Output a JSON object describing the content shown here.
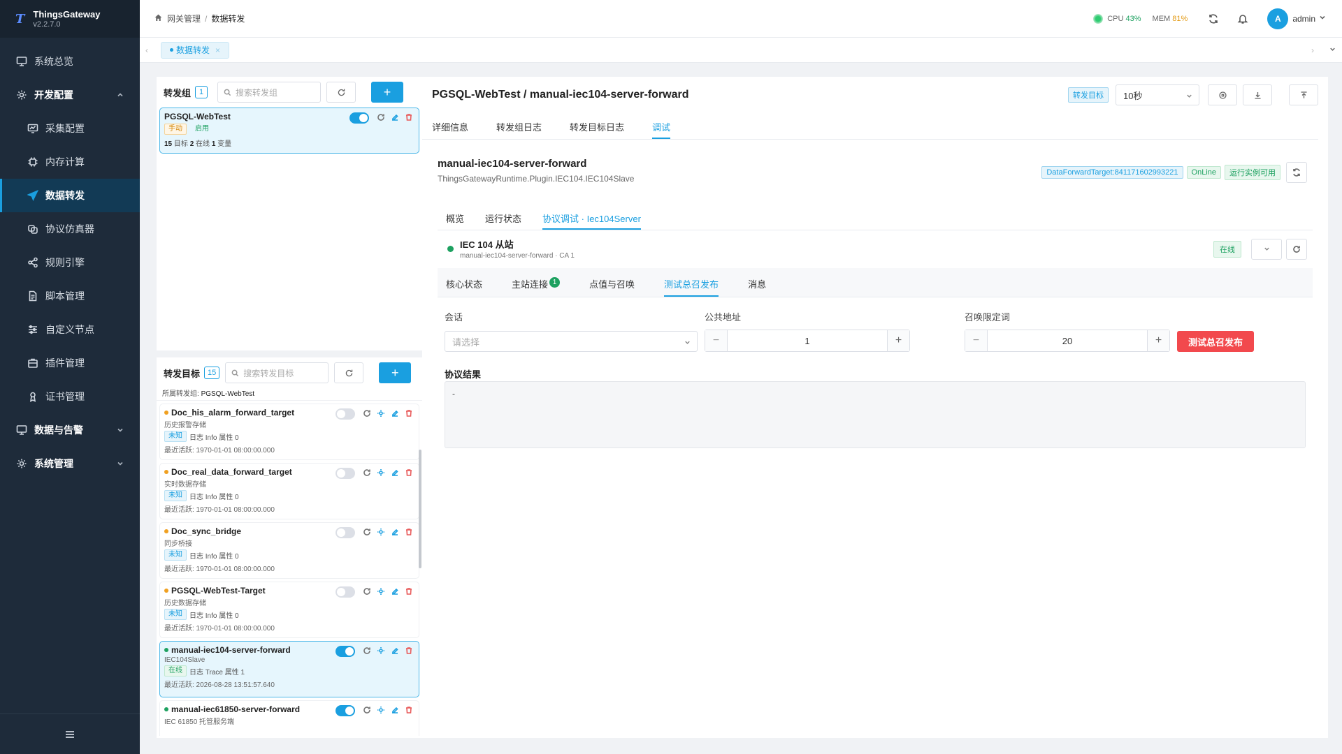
{
  "brand": {
    "logo": "T",
    "name": "ThingsGateway",
    "version": "v2.2.7.0"
  },
  "menu": [
    {
      "label": "系统总览",
      "icon": "monitor-icon",
      "type": "top"
    },
    {
      "label": "开发配置",
      "icon": "gear-icon",
      "type": "group"
    },
    {
      "label": "采集配置",
      "icon": "screen-icon",
      "type": "sub"
    },
    {
      "label": "内存计算",
      "icon": "chip-icon",
      "type": "sub"
    },
    {
      "label": "数据转发",
      "icon": "send-icon",
      "type": "sub-active"
    },
    {
      "label": "协议仿真器",
      "icon": "sim-icon",
      "type": "sub"
    },
    {
      "label": "规则引擎",
      "icon": "share-icon",
      "type": "sub"
    },
    {
      "label": "脚本管理",
      "icon": "file-icon",
      "type": "sub"
    },
    {
      "label": "自定义节点",
      "icon": "sliders-icon",
      "type": "sub"
    },
    {
      "label": "插件管理",
      "icon": "plugin-icon",
      "type": "sub"
    },
    {
      "label": "证书管理",
      "icon": "cert-icon",
      "type": "sub"
    },
    {
      "label": "数据与告警",
      "icon": "monitor2-icon",
      "type": "group-collapsed"
    },
    {
      "label": "系统管理",
      "icon": "gear2-icon",
      "type": "group-collapsed"
    }
  ],
  "header": {
    "crumb_root": "网关管理",
    "crumb_sep": "/",
    "crumb_current": "数据转发",
    "cpu_label": "CPU",
    "cpu_value": "43%",
    "mem_label": "MEM",
    "mem_value": "81%",
    "user_initial": "A",
    "user_name": "admin"
  },
  "tabsbar": {
    "tab_label": "数据转发",
    "close": "×"
  },
  "groups": {
    "title": "转发组",
    "count": "1",
    "search_placeholder": "搜索转发组",
    "add": "+",
    "card": {
      "name": "PGSQL-WebTest",
      "tag_mode": "手动",
      "tag_state": "启用",
      "targets_num": "15",
      "targets_label": "目标",
      "online_num": "2",
      "online_label": "在线",
      "vars_num": "1",
      "vars_label": "变量"
    }
  },
  "targets": {
    "title": "转发目标",
    "count": "15",
    "search_placeholder": "搜索转发目标",
    "add": "+",
    "belongs_label": "所属转发组:",
    "belongs_value": "PGSQL-WebTest",
    "items": [
      {
        "name": "Doc_his_alarm_forward_target",
        "desc": "历史报警存储",
        "status": "未知",
        "log": "日志 Info",
        "attr": "属性 0",
        "last": "最近活跃:  1970-01-01 08:00:00.000",
        "on": false,
        "dot": "orange"
      },
      {
        "name": "Doc_real_data_forward_target",
        "desc": "实时数据存储",
        "status": "未知",
        "log": "日志 Info",
        "attr": "属性 0",
        "last": "最近活跃:  1970-01-01 08:00:00.000",
        "on": false,
        "dot": "orange"
      },
      {
        "name": "Doc_sync_bridge",
        "desc": "同步桥接",
        "status": "未知",
        "log": "日志 Info",
        "attr": "属性 0",
        "last": "最近活跃:  1970-01-01 08:00:00.000",
        "on": false,
        "dot": "orange"
      },
      {
        "name": "PGSQL-WebTest-Target",
        "desc": "历史数据存储",
        "status": "未知",
        "log": "日志 Info",
        "attr": "属性 0",
        "last": "最近活跃:  1970-01-01 08:00:00.000",
        "on": false,
        "dot": "orange"
      },
      {
        "name": "manual-iec104-server-forward",
        "desc": "IEC104Slave",
        "status": "在线",
        "log": "日志 Trace",
        "attr": "属性 1",
        "last": "最近活跃:  2026-08-28 13:51:57.640",
        "on": true,
        "dot": "green"
      },
      {
        "name": "manual-iec61850-server-forward",
        "desc": "IEC 61850 托管服务端",
        "status": "",
        "log": "",
        "attr": "",
        "last": "",
        "on": true,
        "dot": "green"
      }
    ]
  },
  "main": {
    "title": "PGSQL-WebTest / manual-iec104-server-forward",
    "target_tag": "转发目标",
    "interval": "10秒",
    "tabs": [
      "详细信息",
      "转发组日志",
      "转发目标日志",
      "调试"
    ],
    "instance": {
      "name": "manual-iec104-server-forward",
      "plugin": "ThingsGatewayRuntime.Plugin.IEC104.IEC104Slave",
      "id_chip": "DataForwardTarget:841171602993221",
      "online_chip": "OnLine",
      "avail_chip": "运行实例可用"
    },
    "tabs2": [
      "概览",
      "运行状态",
      "协议调试 · Iec104Server"
    ],
    "slave": {
      "title": "IEC 104 从站",
      "sub": "manual-iec104-server-forward · CA 1",
      "status": "在线"
    },
    "tabs3": [
      "核心状态",
      "主站连接",
      "点值与召唤",
      "测试总召发布",
      "消息"
    ],
    "master_count": "1",
    "form": {
      "session_label": "会话",
      "session_placeholder": "请选择",
      "ca_label": "公共地址",
      "ca_value": "1",
      "qoi_label": "召唤限定词",
      "qoi_value": "20",
      "minus": "−",
      "plus": "+",
      "submit": "测试总召发布"
    },
    "result_label": "协议结果",
    "result_value": "-"
  }
}
